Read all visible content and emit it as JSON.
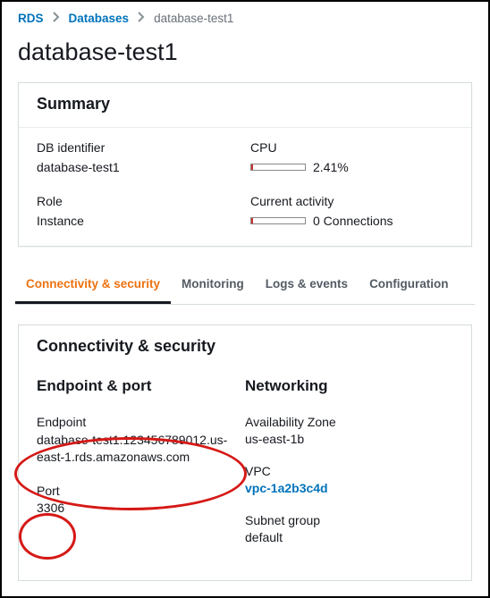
{
  "breadcrumb": {
    "root": "RDS",
    "parent": "Databases",
    "current": "database-test1"
  },
  "page_title": "database-test1",
  "summary": {
    "title": "Summary",
    "db_identifier": {
      "label": "DB identifier",
      "value": "database-test1"
    },
    "cpu": {
      "label": "CPU",
      "value": "2.41%"
    },
    "role": {
      "label": "Role",
      "value": "Instance"
    },
    "current_activity": {
      "label": "Current activity",
      "value": "0 Connections"
    }
  },
  "tabs": {
    "items": [
      {
        "label": "Connectivity & security"
      },
      {
        "label": "Monitoring"
      },
      {
        "label": "Logs & events"
      },
      {
        "label": "Configuration"
      }
    ]
  },
  "connectivity": {
    "title": "Connectivity & security",
    "endpoint_port": {
      "heading": "Endpoint & port",
      "endpoint": {
        "label": "Endpoint",
        "value": "database-test1.123456789012.us-east-1.rds.amazonaws.com"
      },
      "port": {
        "label": "Port",
        "value": "3306"
      }
    },
    "networking": {
      "heading": "Networking",
      "availability_zone": {
        "label": "Availability Zone",
        "value": "us-east-1b"
      },
      "vpc": {
        "label": "VPC",
        "value": "vpc-1a2b3c4d"
      },
      "subnet_group": {
        "label": "Subnet group",
        "value": "default"
      }
    }
  }
}
